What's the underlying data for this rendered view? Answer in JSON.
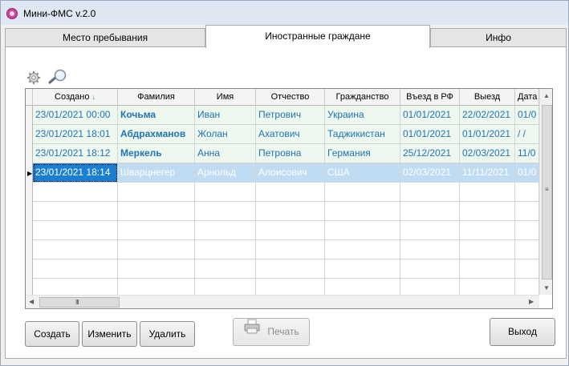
{
  "window": {
    "title": "Мини-ФМС v.2.0",
    "icon": "app-icon"
  },
  "tabs": [
    {
      "label": "Место пребывания",
      "active": false
    },
    {
      "label": "Иностранные граждане",
      "active": true
    },
    {
      "label": "Инфо",
      "active": false
    }
  ],
  "toolbar": {
    "settings_icon": "gear-icon",
    "search_icon": "search-icon"
  },
  "table": {
    "columns": [
      "Создано",
      "Фамилия",
      "Имя",
      "Отчество",
      "Гражданство",
      "Въезд в РФ",
      "Выезд",
      "Дата"
    ],
    "sort_indicator": "↓",
    "rows": [
      [
        "23/01/2021 00:00",
        "Кочьма",
        "Иван",
        "Петрович",
        "Украина",
        "01/01/2021",
        "22/02/2021",
        "01/0"
      ],
      [
        "23/01/2021 18:01",
        "Абдрахманов",
        "Жолан",
        "Ахатович",
        "Таджикистан",
        "01/01/2021",
        "01/01/2021",
        "/  /"
      ],
      [
        "23/01/2021 18:12",
        "Меркель",
        "Анна",
        "Петровна",
        "Германия",
        "25/12/2021",
        "02/03/2021",
        "11/0"
      ],
      [
        "23/01/2021 18:14",
        "Шварцнегер",
        "Арнольд",
        "Алоисович",
        "США",
        "02/03/2021",
        "11/11/2021",
        "01/0"
      ]
    ],
    "selected_row": 3,
    "empty_rows": 6,
    "hscroll_grip": "III",
    "vscroll_grip": "≡"
  },
  "buttons": {
    "create": "Создать",
    "edit": "Изменить",
    "delete": "Удалить",
    "print": "Печать",
    "exit": "Выход"
  },
  "colors": {
    "row_text": "#1f73b7",
    "row_bg": "#edf7ee",
    "selected_bg": "#bfdcf3",
    "selected_cell": "#1a7fd1"
  }
}
